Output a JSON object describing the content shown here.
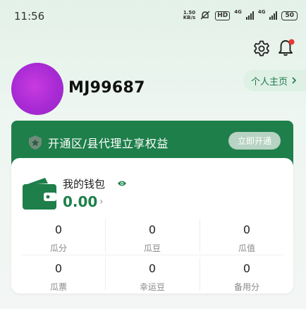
{
  "status_bar": {
    "time": "11:56",
    "speed_value": "1.50",
    "speed_unit": "KB/s",
    "hd": "HD",
    "net1": "4G",
    "net2": "4G",
    "battery": "50"
  },
  "header": {
    "settings_icon": "gear-icon",
    "notifications_icon": "bell-icon",
    "notification_dot_color": "#e53935"
  },
  "profile": {
    "username": "MJ99687",
    "home_button": "个人主页",
    "avatar_color": "#b030d8"
  },
  "promo": {
    "title": "开通区/县代理立享权益",
    "button": "立即开通",
    "background_color": "#1e7f4a"
  },
  "wallet": {
    "title": "我的钱包",
    "balance": "0.00",
    "stats": [
      {
        "value": "0",
        "label": "瓜分"
      },
      {
        "value": "0",
        "label": "瓜豆"
      },
      {
        "value": "0",
        "label": "瓜值"
      },
      {
        "value": "0",
        "label": "瓜票"
      },
      {
        "value": "0",
        "label": "幸运豆"
      },
      {
        "value": "0",
        "label": "备用分"
      }
    ]
  }
}
